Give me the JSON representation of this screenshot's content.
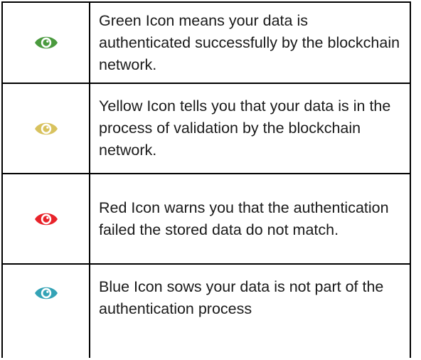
{
  "legend": {
    "rows": [
      {
        "icon": "eye-icon",
        "color": "#4a9a3e",
        "text": "Green Icon means your data is authenticated successfully by the blockchain network."
      },
      {
        "icon": "eye-icon",
        "color": "#d8c25e",
        "text": "Yellow Icon tells you that your data is in the process of validation by the blockchain network."
      },
      {
        "icon": "eye-icon",
        "color": "#e8232a",
        "text": "Red Icon warns you that the authentication failed the stored data do not match."
      },
      {
        "icon": "eye-icon",
        "color": "#34a3b6",
        "text": "Blue Icon sows your data is not part of the authentication process"
      }
    ]
  }
}
